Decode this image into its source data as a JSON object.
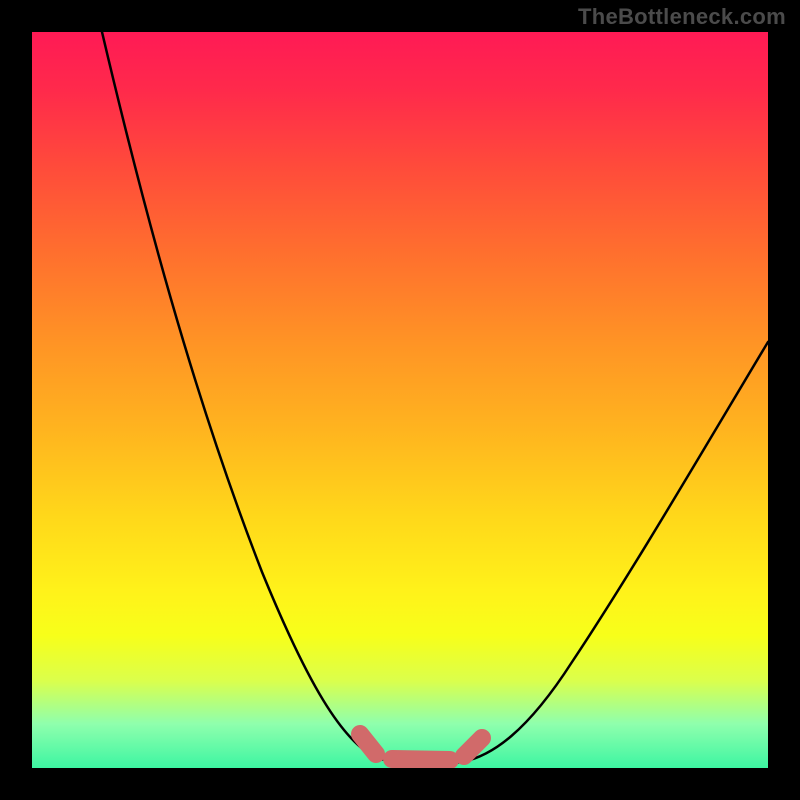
{
  "watermark": {
    "text": "TheBottleneck.com"
  },
  "chart_data": {
    "type": "line",
    "title": "",
    "xlabel": "",
    "ylabel": "",
    "xlim": [
      0,
      100
    ],
    "ylim": [
      0,
      100
    ],
    "series": [
      {
        "name": "bottleneck-curve",
        "x": [
          10,
          15,
          20,
          25,
          30,
          35,
          40,
          45,
          48,
          50,
          52,
          55,
          58,
          60,
          65,
          70,
          75,
          80,
          85,
          90,
          95,
          100
        ],
        "values": [
          100,
          85,
          70,
          56,
          42,
          30,
          19,
          9,
          3,
          1,
          0,
          0,
          0,
          1,
          4,
          9,
          16,
          24,
          33,
          43,
          54,
          65
        ]
      },
      {
        "name": "tolerance-band",
        "x": [
          48,
          50,
          52,
          55,
          58,
          60
        ],
        "values": [
          3,
          1,
          0,
          0,
          0,
          1
        ]
      }
    ],
    "annotations": [],
    "colors": {
      "background_gradient_top": "#ff1a55",
      "background_gradient_mid": "#ffd81a",
      "background_gradient_bottom": "#3df5a2",
      "curve": "#000000",
      "tolerance": "#d16a6a",
      "frame": "#000000"
    }
  }
}
